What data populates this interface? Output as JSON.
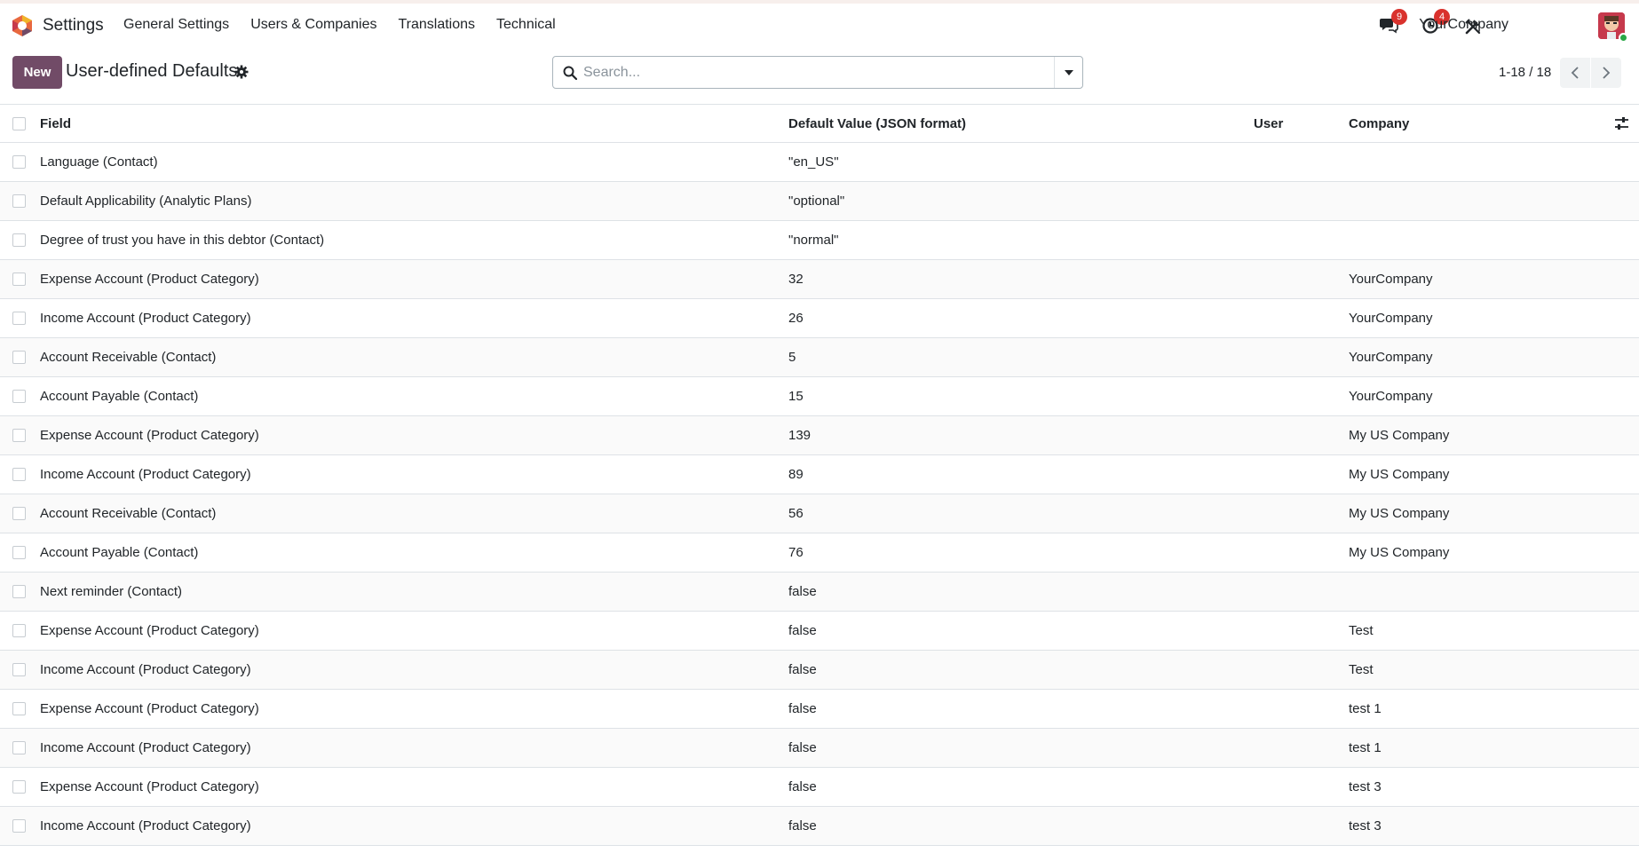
{
  "navbar": {
    "app_name": "Settings",
    "menu": [
      "General Settings",
      "Users & Companies",
      "Translations",
      "Technical"
    ],
    "messages_count": "9",
    "activities_count": "4",
    "company": "YourCompany"
  },
  "control_panel": {
    "new_label": "New",
    "title": "User-defined Defaults",
    "search_placeholder": "Search...",
    "pager": "1-18 / 18"
  },
  "table": {
    "columns": {
      "field": "Field",
      "value": "Default Value (JSON format)",
      "user": "User",
      "company": "Company"
    },
    "rows": [
      {
        "field": "Language (Contact)",
        "value": "\"en_US\"",
        "user": "",
        "company": ""
      },
      {
        "field": "Default Applicability (Analytic Plans)",
        "value": "\"optional\"",
        "user": "",
        "company": ""
      },
      {
        "field": "Degree of trust you have in this debtor (Contact)",
        "value": "\"normal\"",
        "user": "",
        "company": ""
      },
      {
        "field": "Expense Account (Product Category)",
        "value": "32",
        "user": "",
        "company": "YourCompany"
      },
      {
        "field": "Income Account (Product Category)",
        "value": "26",
        "user": "",
        "company": "YourCompany"
      },
      {
        "field": "Account Receivable (Contact)",
        "value": "5",
        "user": "",
        "company": "YourCompany"
      },
      {
        "field": "Account Payable (Contact)",
        "value": "15",
        "user": "",
        "company": "YourCompany"
      },
      {
        "field": "Expense Account (Product Category)",
        "value": "139",
        "user": "",
        "company": "My US Company"
      },
      {
        "field": "Income Account (Product Category)",
        "value": "89",
        "user": "",
        "company": "My US Company"
      },
      {
        "field": "Account Receivable (Contact)",
        "value": "56",
        "user": "",
        "company": "My US Company"
      },
      {
        "field": "Account Payable (Contact)",
        "value": "76",
        "user": "",
        "company": "My US Company"
      },
      {
        "field": "Next reminder (Contact)",
        "value": "false",
        "user": "",
        "company": ""
      },
      {
        "field": "Expense Account (Product Category)",
        "value": "false",
        "user": "",
        "company": "Test"
      },
      {
        "field": "Income Account (Product Category)",
        "value": "false",
        "user": "",
        "company": "Test"
      },
      {
        "field": "Expense Account (Product Category)",
        "value": "false",
        "user": "",
        "company": "test 1"
      },
      {
        "field": "Income Account (Product Category)",
        "value": "false",
        "user": "",
        "company": "test 1"
      },
      {
        "field": "Expense Account (Product Category)",
        "value": "false",
        "user": "",
        "company": "test 3"
      },
      {
        "field": "Income Account (Product Category)",
        "value": "false",
        "user": "",
        "company": "test 3"
      }
    ]
  },
  "colors": {
    "brand": "#714b67",
    "badge": "#d9322d",
    "online": "#28a745"
  },
  "icons": [
    "odoo-logo-icon",
    "chat-icon",
    "clock-icon",
    "tools-icon",
    "gear-icon",
    "search-icon",
    "chevron-left-icon",
    "chevron-right-icon",
    "column-settings-icon"
  ]
}
